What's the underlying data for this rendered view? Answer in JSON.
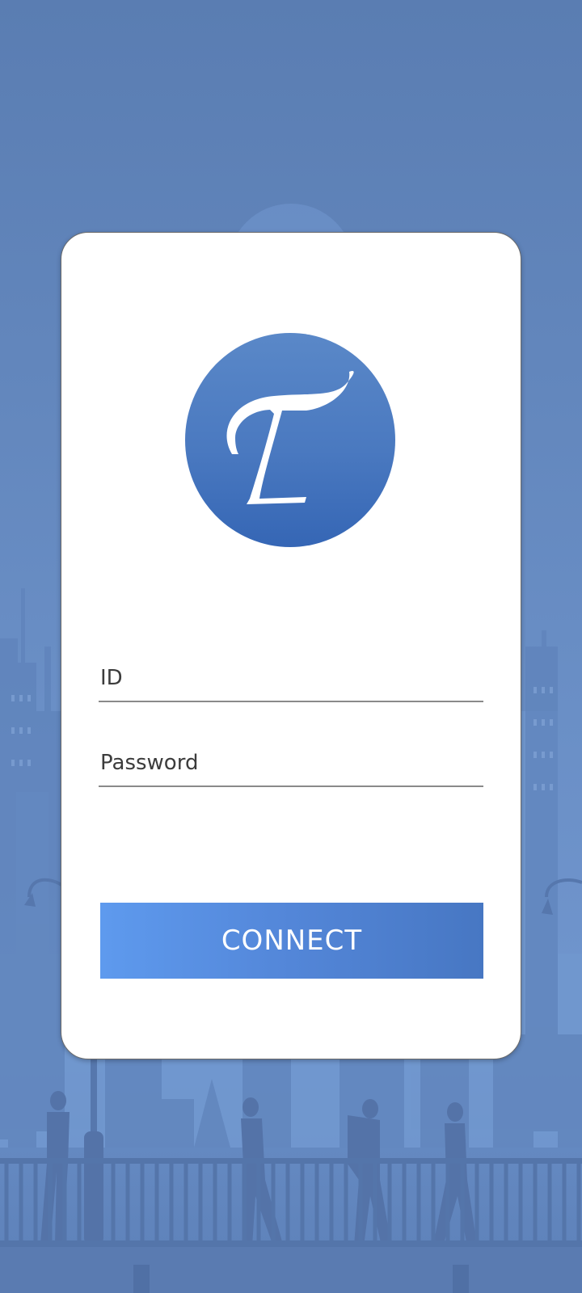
{
  "login": {
    "id_placeholder": "ID",
    "password_placeholder": "Password",
    "connect_label": "CONNECT"
  },
  "logo": {
    "letter": "T",
    "icon": "t-letter-logo-icon",
    "color": "#4a79c0"
  },
  "theme": {
    "background": "#6a8fc6",
    "button_start": "#5e9aee",
    "button_end": "#4777c3"
  }
}
